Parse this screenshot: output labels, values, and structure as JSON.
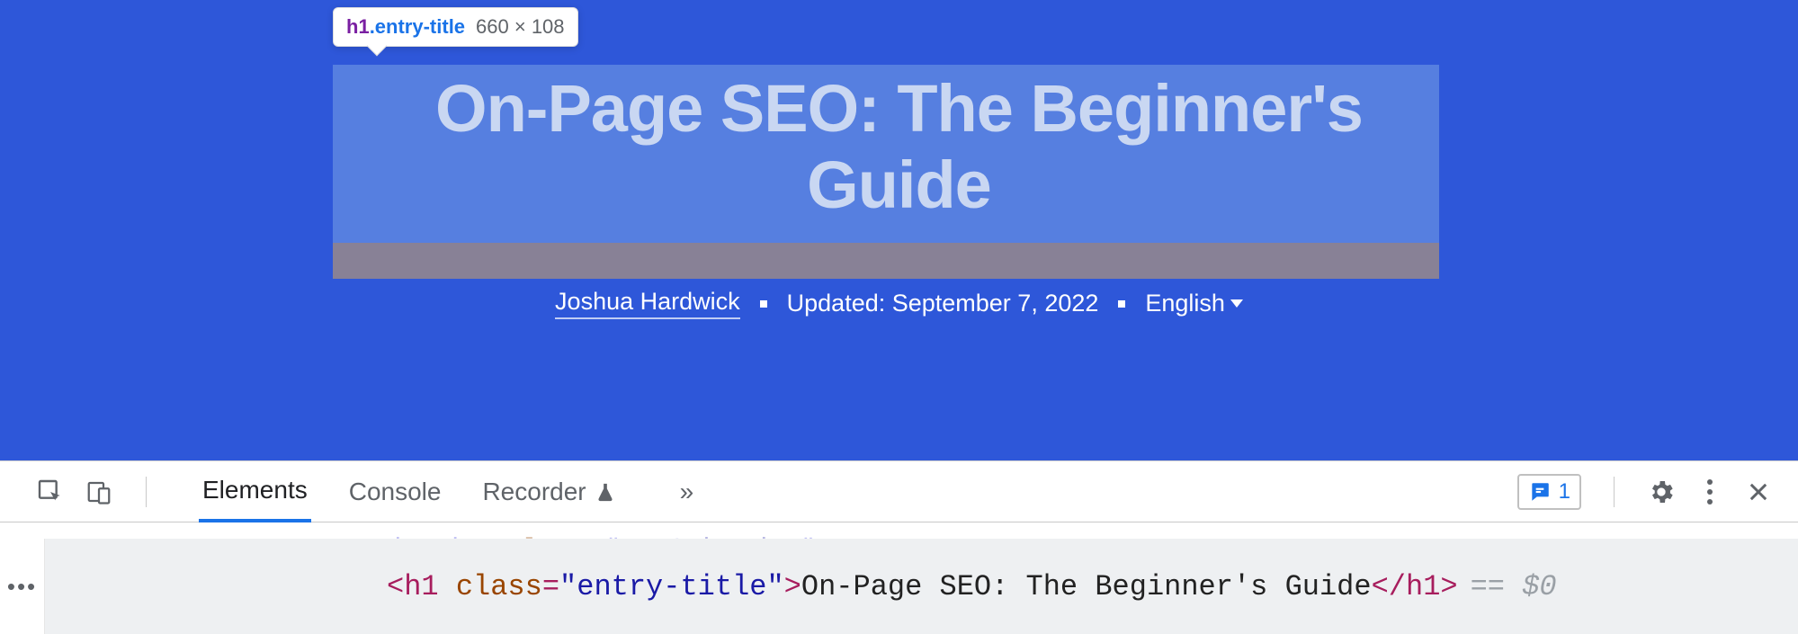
{
  "page": {
    "title": "On-Page SEO: The Beginner's Guide",
    "author": "Joshua Hardwick",
    "updated": "Updated: September 7, 2022",
    "language": "English"
  },
  "inspect_tooltip": {
    "tag": "h1",
    "class": ".entry-title",
    "dimensions": "660 × 108"
  },
  "devtools": {
    "tabs": {
      "elements": "Elements",
      "console": "Console",
      "recorder": "Recorder"
    },
    "overflow": "»",
    "issues_count": "1",
    "faded_row": {
      "tag": "header",
      "attr": "class",
      "val": "post-header"
    },
    "code_row": {
      "open_bracket": "<",
      "tag": "h1",
      "attr_name": "class",
      "eq": "=",
      "quote": "\"",
      "attr_value": "entry-title",
      "close_open": ">",
      "content": "On-Page SEO: The Beginner's Guide",
      "close_tag_open": "</",
      "close_bracket": ">",
      "ref": "== $0"
    },
    "expand_dots": "•••"
  }
}
